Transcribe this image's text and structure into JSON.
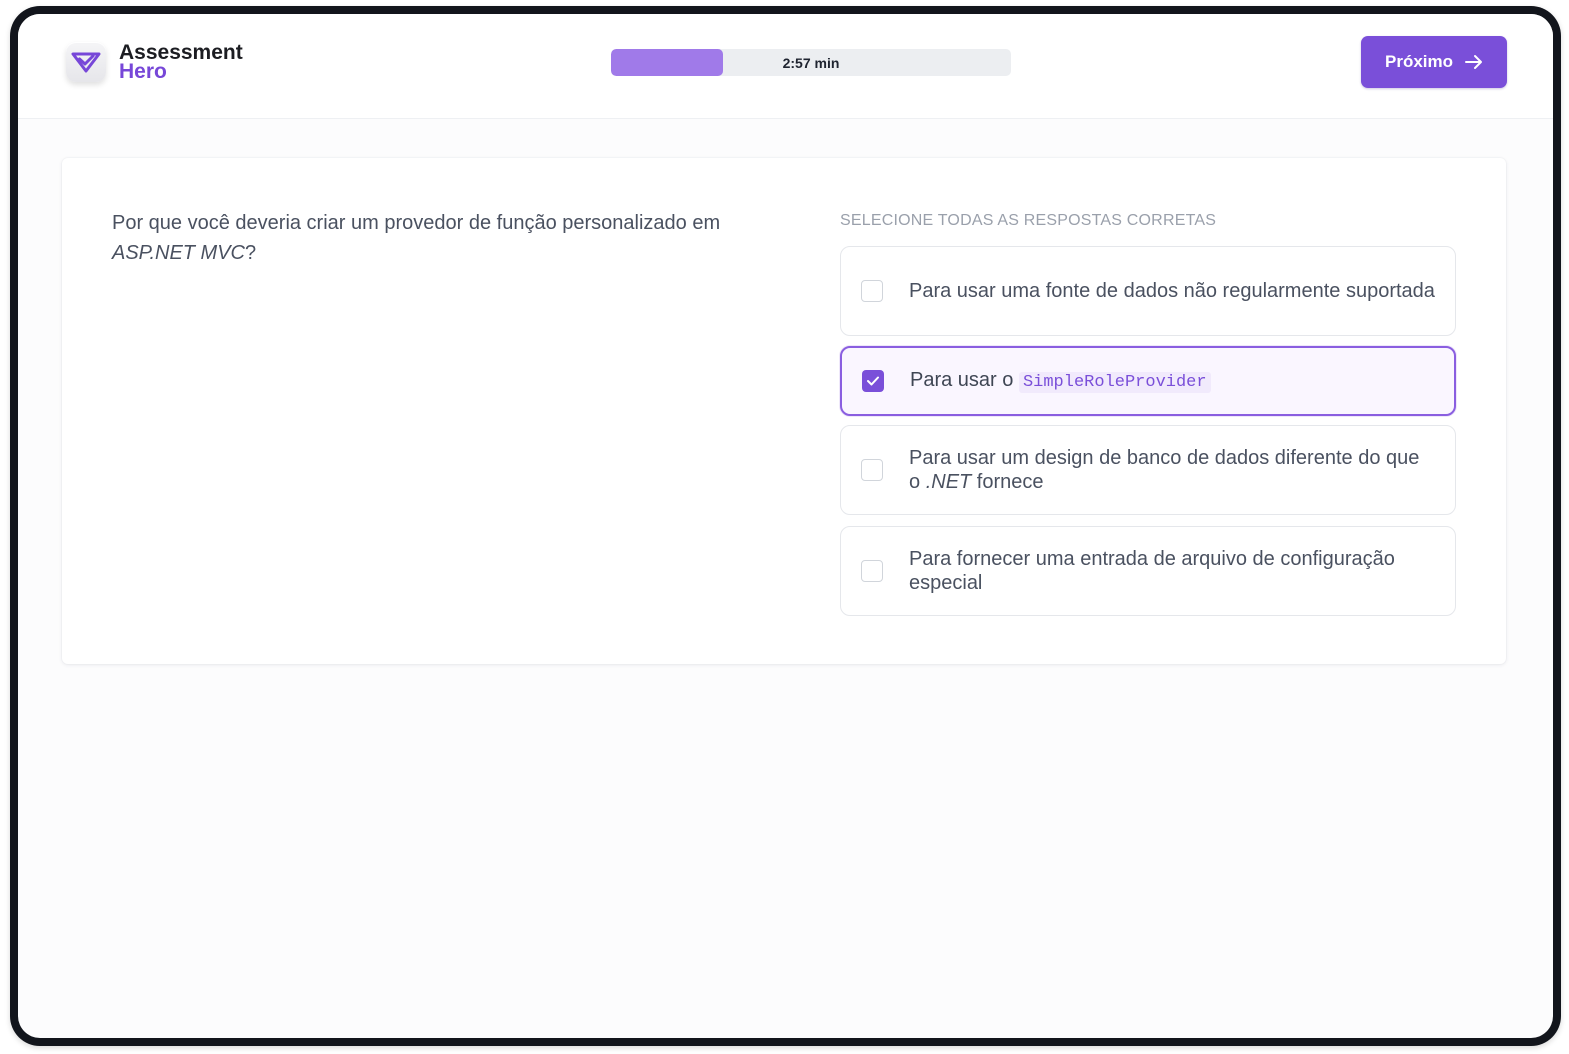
{
  "brand": {
    "line1": "Assessment",
    "line2": "Hero",
    "logo_icon": "check-shield-icon"
  },
  "timer": {
    "label": "2:57 min",
    "progress_fraction": 0.28
  },
  "toolbar": {
    "next_label": "Próximo",
    "next_icon": "arrow-right-icon"
  },
  "question": {
    "text_before": "Por que você deveria criar um provedor de função personalizado em ",
    "text_italic": "ASP.NET MVC",
    "text_after": "?"
  },
  "instruction": "SELECIONE TODAS AS RESPOSTAS CORRETAS",
  "options": [
    {
      "text": "Para usar uma fonte de dados não regularmente suportada",
      "checked": false
    },
    {
      "text_before": "Para usar o ",
      "code": "SimpleRoleProvider",
      "checked": true
    },
    {
      "text_before": "Para usar um design de banco de dados diferente do que o ",
      "text_italic": ".NET",
      "text_after": " fornece",
      "checked": false
    },
    {
      "text": "Para fornecer uma entrada de arquivo de configuração especial",
      "checked": false
    }
  ],
  "colors": {
    "accent": "#7a4fd9",
    "progress_fill": "#a07ae9",
    "selected_bg": "#faf6ff",
    "text": "#4a5160",
    "muted": "#9aa0ab"
  }
}
